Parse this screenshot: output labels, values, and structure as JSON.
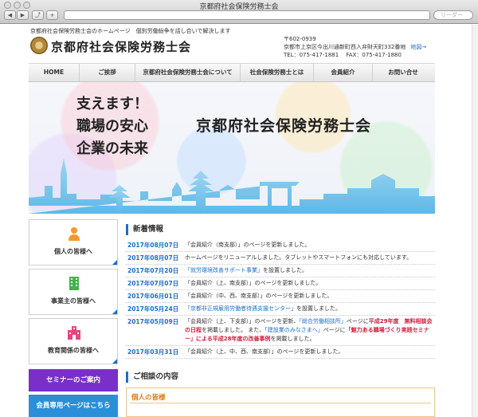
{
  "browser": {
    "window_title": "京都府社会保険労務士会",
    "back_label": "◀",
    "forward_label": "▶",
    "share_label": "⤴",
    "new_tab_label": "+",
    "reader_label": "リーダー"
  },
  "header": {
    "tagline": "京都府社会保険労務士会のホームページ　個別労働紛争を話し合いで解決します",
    "site_title": "京都府社会保険労務士会",
    "postal": "〒602-0939",
    "address": "京都市上京区今出川通新町西入弁財天町332番地",
    "map_link": "地図→",
    "tel": "TEL：075-417-1881　 FAX：075-417-1880"
  },
  "nav": {
    "items": [
      {
        "label": "HOME"
      },
      {
        "label": "ご挨拶"
      },
      {
        "label": "京都府社会保険労務士会について"
      },
      {
        "label": "社会保険労務士とは"
      },
      {
        "label": "会員紹介"
      },
      {
        "label": "お問い合せ"
      }
    ]
  },
  "hero": {
    "copy_line1": "支えます！",
    "copy_line2": "職場の安心",
    "copy_line3": "企業の未来",
    "title": "京都府社会保険労務士会"
  },
  "sidebar": {
    "cards": [
      {
        "label": "個人の皆様へ",
        "icon": "person-icon"
      },
      {
        "label": "事業主の皆様へ",
        "icon": "building-icon"
      },
      {
        "label": "教育関係の皆様へ",
        "icon": "school-icon"
      }
    ],
    "seminar_label": "セミナーのご案内",
    "member_label": "会員専用ページはこちら"
  },
  "news": {
    "heading": "新着情報",
    "items": [
      {
        "date": "2017年08月07日",
        "text": "「会員紹介（南支部）」のページを更新しました。"
      },
      {
        "date": "2017年08月07日",
        "text": "ホームページをリニューアルしました。タブレットやスマートフォンにも対応しています。"
      },
      {
        "date": "2017年07月20日",
        "link": "「就労環境改善サポート事業」",
        "after": "を設置しました。"
      },
      {
        "date": "2017年07月07日",
        "text": "「会員紹介（上、南支部）」のページを更新しました。"
      },
      {
        "date": "2017年06月01日",
        "text": "「会員紹介（中、西、南支部）」のページを更新しました。"
      },
      {
        "date": "2017年05月24日",
        "link": "「京都非正規雇用労働者待遇支援センター」",
        "after": "を設置しました。"
      }
    ],
    "rich": {
      "date": "2017年05月09日",
      "t1": "「会員紹介（上、下支部）」のページを更新、",
      "l1": "「総合労働相談所」",
      "t2": "ページに",
      "r1": "平成29年度　無料相談会の日程",
      "t3": "を掲載しました。 また、",
      "l2": "「建設業のみなさまへ」",
      "t4": "ページに",
      "r2": "「魅力ある職場づくり実践セミナー」による平成28年度の改善事例",
      "t5": "を掲載しました。"
    },
    "last": {
      "date": "2017年03月31日",
      "text": "「会員紹介（上、中、西、南支部）」のページを更新しました。"
    }
  },
  "consult": {
    "heading": "ご相談の内容",
    "box_title": "個人の皆様"
  },
  "colors": {
    "accent_blue": "#1a6fcf",
    "seminar_purple": "#7a2fc8",
    "member_blue": "#2a8fd8",
    "highlight_red": "#d61b3c",
    "consult_orange": "#e07d18"
  }
}
